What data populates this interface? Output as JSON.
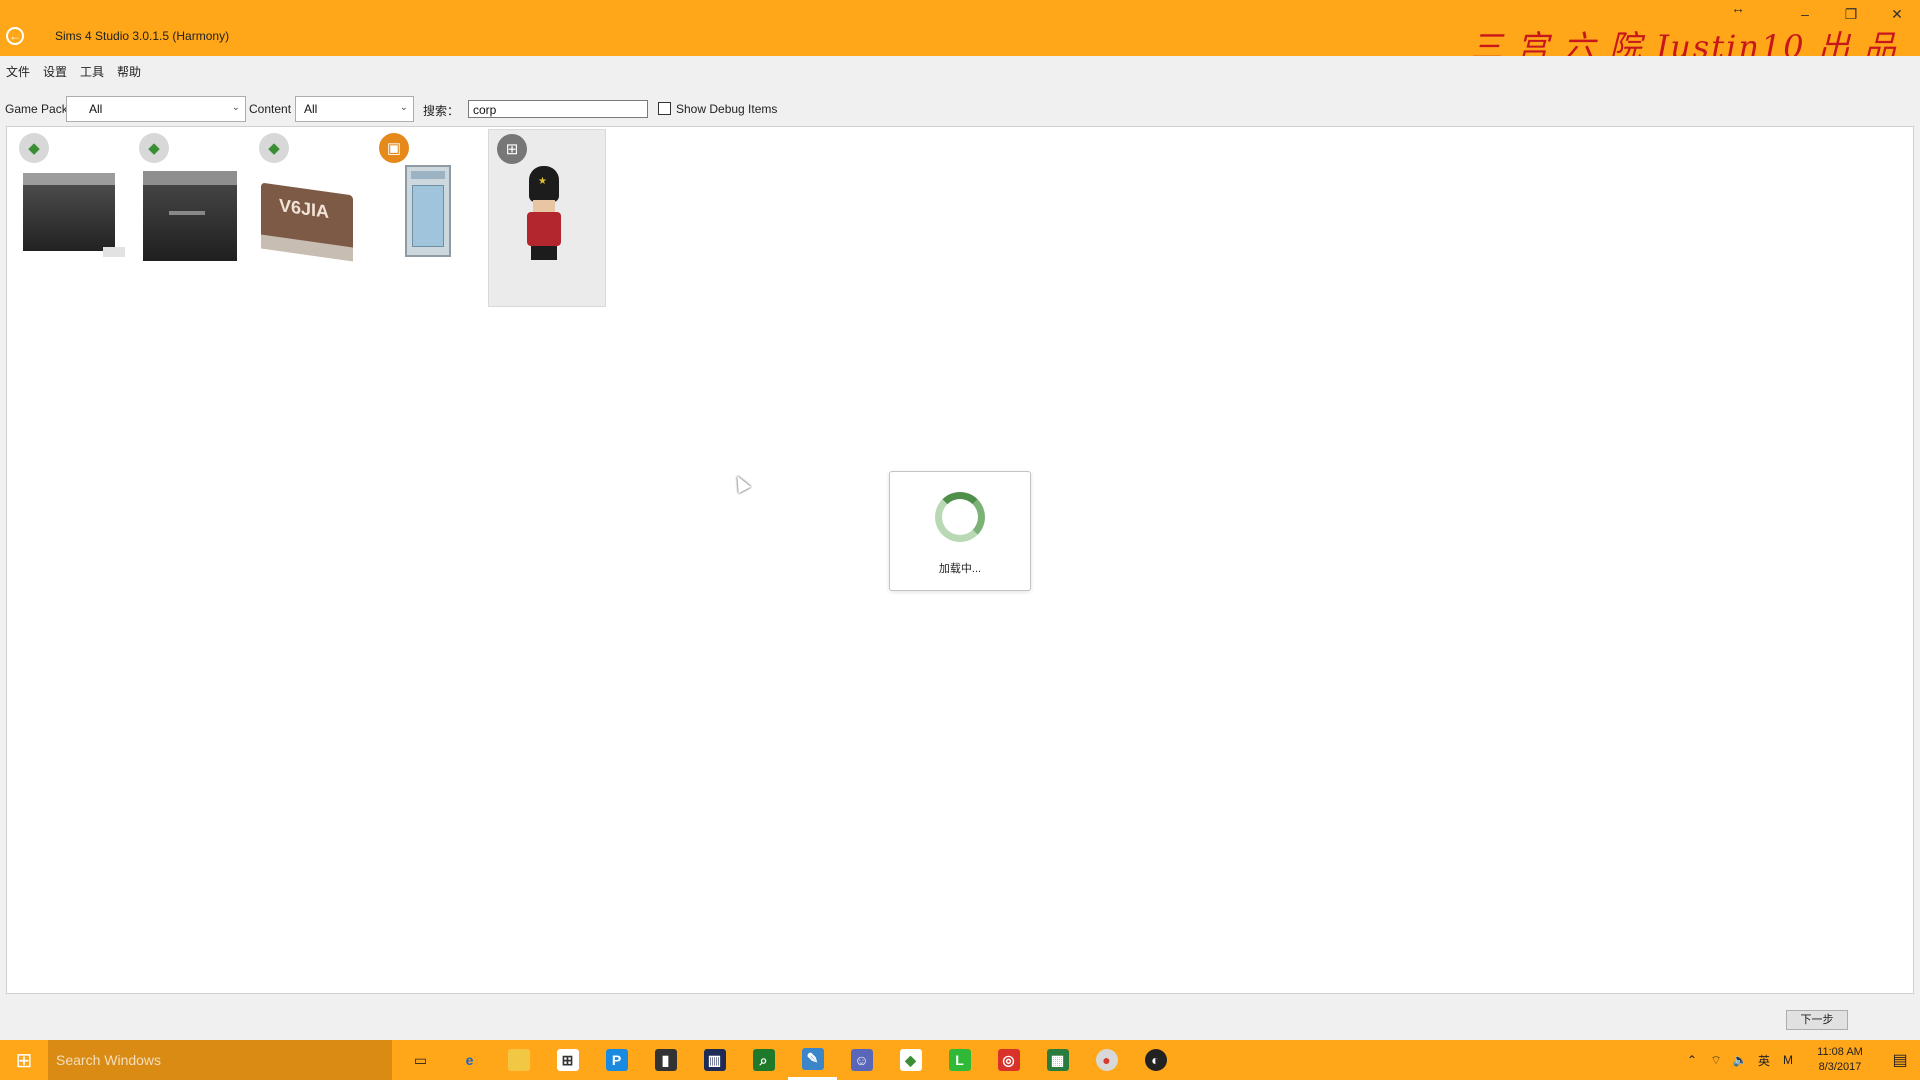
{
  "window": {
    "title": "Sims 4 Studio 3.0.1.5 (Harmony)",
    "watermark": "三 宫 六 院 Justin10 出 品",
    "controls": {
      "minimize": "–",
      "restore": "❐",
      "close": "✕",
      "resize": "↔"
    }
  },
  "menu": [
    "文件",
    "设置",
    "工具",
    "帮助"
  ],
  "filters": {
    "game_pack_label": "Game Pack",
    "game_pack_value": "All",
    "content_label": "Content",
    "content_value": "All",
    "search_label": "搜索：",
    "search_value": "corp",
    "debug_label": "Show Debug Items",
    "debug_checked": false
  },
  "items": [
    {
      "name": "counter",
      "badge": "plumbob-icon",
      "selected": false
    },
    {
      "name": "cabinet",
      "badge": "plumbob-icon",
      "selected": false
    },
    {
      "name": "sign",
      "badge": "plumbob-icon",
      "selected": false,
      "sign_text": "V6JIA"
    },
    {
      "name": "fridge",
      "badge": "pack-icon",
      "selected": false
    },
    {
      "name": "toy-soldier",
      "badge": "gift-icon",
      "selected": true
    }
  ],
  "loading": {
    "text": "加载中..."
  },
  "footer": {
    "next_label": "下一步"
  },
  "taskbar": {
    "search_placeholder": "Search Windows",
    "tray": {
      "lang": "英",
      "time": "11:08 AM",
      "date": "8/3/2017"
    }
  },
  "colors": {
    "accent": "#ffa719",
    "watermark": "#c8161d",
    "plumbob": "#3a8f33"
  }
}
